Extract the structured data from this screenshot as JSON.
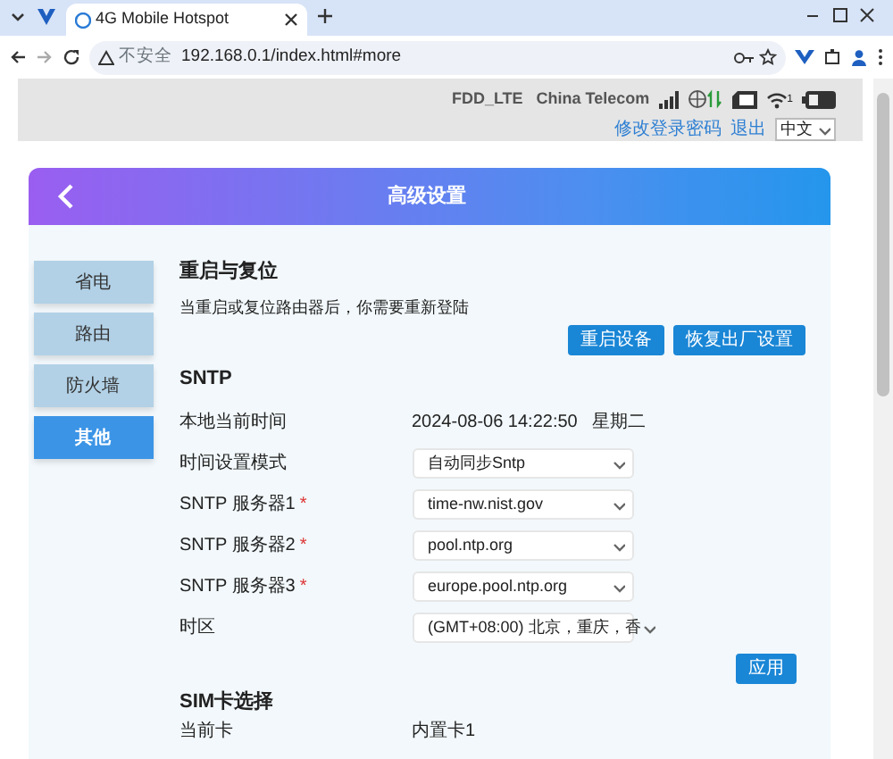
{
  "browser": {
    "tab_title": "4G Mobile Hotspot",
    "security_label": "不安全",
    "url": "192.168.0.1/index.html#more"
  },
  "status": {
    "network_type": "FDD_LTE",
    "carrier": "China Telecom",
    "wifi_clients": "1",
    "links": [
      "修改登录密码",
      "退出"
    ],
    "language": "中文"
  },
  "page": {
    "title": "高级设置",
    "sidebar": [
      {
        "label": "省电",
        "selected": false
      },
      {
        "label": "路由",
        "selected": false
      },
      {
        "label": "防火墙",
        "selected": false
      },
      {
        "label": "其他",
        "selected": true
      }
    ],
    "reset": {
      "title": "重启与复位",
      "description": "当重启或复位路由器后，你需要重新登陆",
      "buttons": [
        "重启设备",
        "恢复出厂设置"
      ]
    },
    "sntp": {
      "title": "SNTP",
      "rows": [
        {
          "kind": "text",
          "label": "本地当前时间",
          "value": "2024-08-06 14:22:50   星期二"
        },
        {
          "kind": "select",
          "label": "时间设置模式",
          "value": "自动同步Sntp"
        },
        {
          "kind": "select",
          "label": "SNTP 服务器1",
          "required_mark": "*",
          "value": "time-nw.nist.gov"
        },
        {
          "kind": "select",
          "label": "SNTP 服务器2",
          "required_mark": "*",
          "value": "pool.ntp.org"
        },
        {
          "kind": "select",
          "label": "SNTP 服务器3",
          "required_mark": "*",
          "value": "europe.pool.ntp.org"
        },
        {
          "kind": "select",
          "label": "时区",
          "value": "(GMT+08:00) 北京，重庆，香"
        }
      ],
      "apply": "应用"
    },
    "sim": {
      "title": "SIM卡选择",
      "rows": [
        {
          "kind": "text",
          "label": "当前卡",
          "value": "内置卡1"
        }
      ]
    }
  }
}
